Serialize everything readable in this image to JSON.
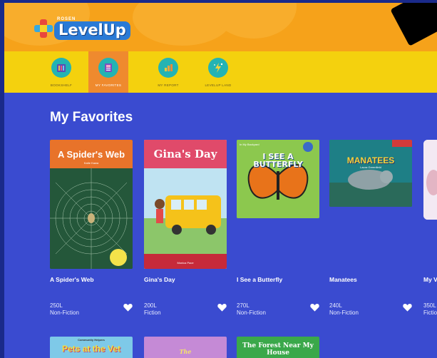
{
  "brand": {
    "publisher": "ROSEN",
    "name": "LevelUp"
  },
  "nav": [
    {
      "label": "BOOKSHELF",
      "icon": "bookshelf-icon",
      "active": false
    },
    {
      "label": "MY FAVORITES",
      "icon": "favorites-icon",
      "active": true
    },
    {
      "label": "MY REPORT",
      "icon": "report-icon",
      "active": false
    },
    {
      "label": "LEVELUP LAND",
      "icon": "levelup-land-icon",
      "active": false
    }
  ],
  "page": {
    "title": "My Favorites"
  },
  "books": [
    {
      "title": "A Spider's Web",
      "cover_title": "A Spider's Web",
      "cover_author": "Katie Kawa",
      "level": "250L",
      "genre": "Non-Fiction",
      "favorited": true
    },
    {
      "title": "Gina's Day",
      "cover_title": "Gina's Day",
      "cover_author": "Monica Pace",
      "level": "200L",
      "genre": "Fiction",
      "favorited": true
    },
    {
      "title": "I See a Butterfly",
      "cover_title": "I SEE A BUTTERFLY",
      "cover_series": "In My Backyard",
      "level": "270L",
      "genre": "Non-Fiction",
      "favorited": true
    },
    {
      "title": "Manatees",
      "cover_title": "MANATEES",
      "cover_author": "Laura Greenfield",
      "level": "240L",
      "genre": "Non-Fiction",
      "favorited": true
    },
    {
      "title": "My V",
      "level": "350L",
      "genre": "Fiction",
      "favorited": true
    }
  ],
  "more_books": [
    {
      "series": "Community Helpers",
      "cover_title": "Pets at the Vet"
    },
    {
      "cover_title": "The"
    },
    {
      "cover_title": "The Forest Near My House"
    }
  ],
  "colors": {
    "header_orange": "#f6a21a",
    "nav_yellow": "#f4d10e",
    "nav_active": "#ef8a2e",
    "content_blue": "#3a4bd0",
    "nav_icon_teal": "#24b3b3"
  }
}
